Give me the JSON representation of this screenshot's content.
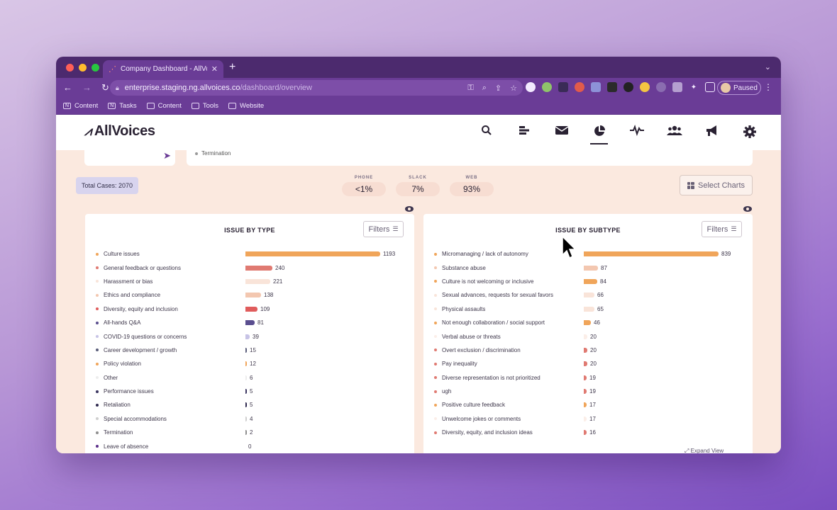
{
  "browser": {
    "tab_title": "Company Dashboard - AllVoice",
    "url_host": "enterprise.staging.ng.allvoices.co",
    "url_path": "/dashboard/overview",
    "profile_label": "Paused",
    "bookmarks": [
      "Content",
      "Tasks",
      "Content",
      "Tools",
      "Website"
    ]
  },
  "app": {
    "logo_text": "AllVoices",
    "nav_icons": [
      "search-icon",
      "bars-icon",
      "mail-icon",
      "pie-chart-icon",
      "pulse-icon",
      "users-icon",
      "megaphone-icon",
      "gear-icon"
    ]
  },
  "top": {
    "partial_item": "Termination"
  },
  "summary": {
    "total_cases": "Total Cases: 2070",
    "channels": [
      {
        "label": "PHONE",
        "value": "<1%"
      },
      {
        "label": "SLACK",
        "value": "7%"
      },
      {
        "label": "WEB",
        "value": "93%"
      }
    ],
    "select_charts": "Select Charts"
  },
  "colors": {
    "orange": "#f0a55a",
    "salmon": "#e07a72",
    "peach": "#f3c7b0",
    "light_peach": "#f9e4d9",
    "purple": "#5a4e8f",
    "lavender": "#c7c3e6",
    "navy": "#3b3560"
  },
  "chart_data": [
    {
      "type": "bar",
      "title": "ISSUE BY TYPE",
      "filters_label": "Filters",
      "categories": [
        "Culture issues",
        "General feedback or questions",
        "Harassment or bias",
        "Ethics and compliance",
        "Diversity, equity and inclusion",
        "All-hands Q&A",
        "COVID-19 questions or concerns",
        "Career development / growth",
        "Policy violation",
        "Other",
        "Performance issues",
        "Retaliation",
        "Special accommodations",
        "Termination",
        "Leave of absence"
      ],
      "values": [
        1193,
        240,
        221,
        138,
        109,
        81,
        39,
        15,
        12,
        6,
        5,
        5,
        4,
        2,
        0
      ],
      "colors": [
        "#f0a55a",
        "#e07a72",
        "#f9e4d9",
        "#f3c7b0",
        "#e05c5c",
        "#5a4e8f",
        "#c7c3e6",
        "#5a5d7a",
        "#f0a55a",
        "#ededed",
        "#3b3560",
        "#2f2a4f",
        "#cfcfcf",
        "#8e8e8e",
        "#5b2f8a"
      ]
    },
    {
      "type": "bar",
      "title": "ISSUE BY SUBTYPE",
      "filters_label": "Filters",
      "categories": [
        "Micromanaging / lack of autonomy",
        "Substance abuse",
        "Culture is not welcoming or inclusive",
        "Sexual advances, requests for sexual favors",
        "Physical assaults",
        "Not enough collaboration / social support",
        "Verbal abuse or threats",
        "Overt exclusion / discrimination",
        "Pay inequality",
        "Diverse representation is not prioritized",
        "ugh",
        "Positive culture feedback",
        "Unwelcome jokes or comments",
        "Diversity, equity, and inclusion ideas"
      ],
      "values": [
        839,
        87,
        84,
        66,
        65,
        46,
        20,
        20,
        20,
        19,
        19,
        17,
        17,
        16
      ],
      "colors": [
        "#f0a55a",
        "#f3c7b0",
        "#f0a55a",
        "#f9e4d9",
        "#f9e4d9",
        "#f0a55a",
        "#fbeee8",
        "#e07a72",
        "#e07a72",
        "#e07a72",
        "#e07a72",
        "#f0a55a",
        "#fbeee8",
        "#e07a72"
      ]
    }
  ],
  "expand_view": "Expand View"
}
